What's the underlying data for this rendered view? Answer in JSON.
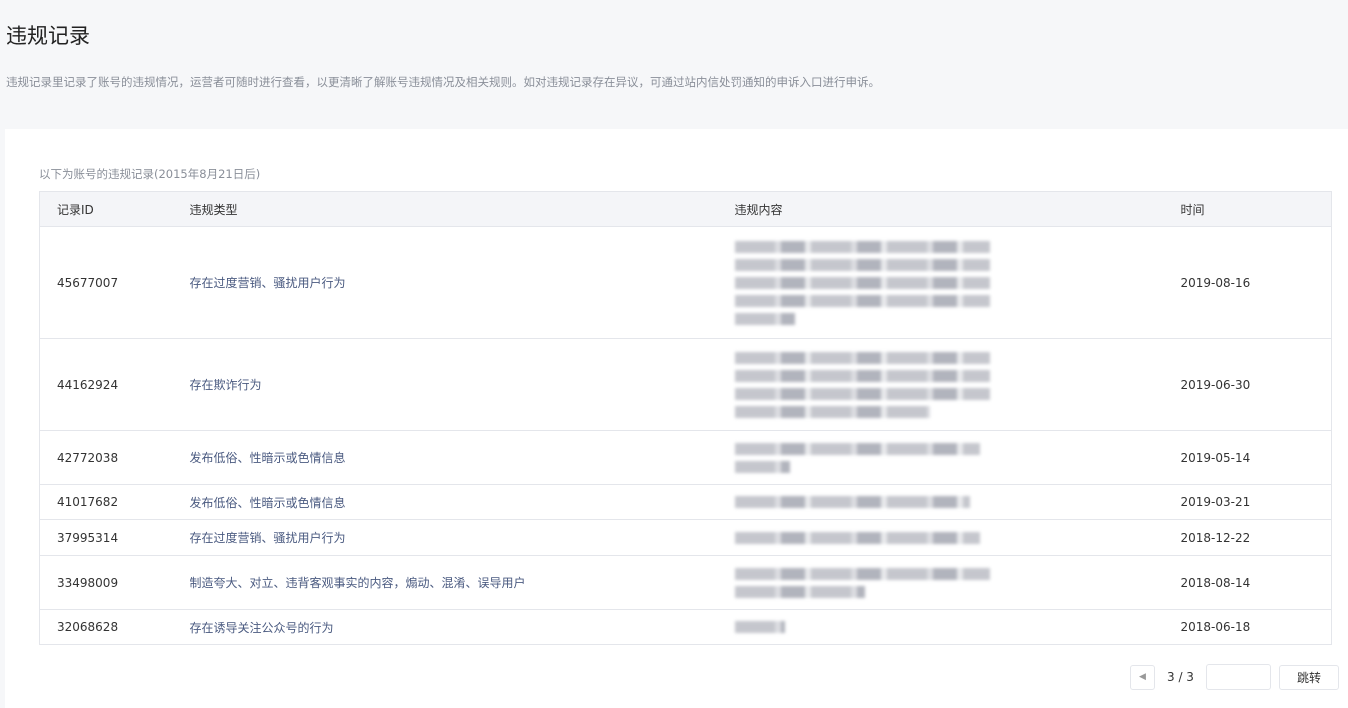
{
  "page": {
    "title": "违规记录",
    "description": "违规记录里记录了账号的违规情况，运营者可随时进行查看，以更清晰了解账号违规情况及相关规则。如对违规记录存在异议，可通过站内信处罚通知的申诉入口进行申诉。"
  },
  "table": {
    "subtitle": "以下为账号的违规记录(2015年8月21日后)",
    "headers": [
      "记录ID",
      "违规类型",
      "违规内容",
      "时间"
    ],
    "rows": [
      {
        "id": "45677007",
        "type": "存在过度营销、骚扰用户行为",
        "date": "2019-08-16"
      },
      {
        "id": "44162924",
        "type": "存在欺诈行为",
        "date": "2019-06-30"
      },
      {
        "id": "42772038",
        "type": "发布低俗、性暗示或色情信息",
        "date": "2019-05-14"
      },
      {
        "id": "41017682",
        "type": "发布低俗、性暗示或色情信息",
        "date": "2019-03-21"
      },
      {
        "id": "37995314",
        "type": "存在过度营销、骚扰用户行为",
        "date": "2018-12-22"
      },
      {
        "id": "33498009",
        "type": "制造夸大、对立、违背客观事实的内容，煽动、混淆、误导用户",
        "date": "2018-08-14"
      },
      {
        "id": "32068628",
        "type": "存在诱导关注公众号的行为",
        "date": "2018-06-18"
      }
    ]
  },
  "pagination": {
    "page": "3 / 3",
    "jump_label": "跳转",
    "jump_value": ""
  }
}
